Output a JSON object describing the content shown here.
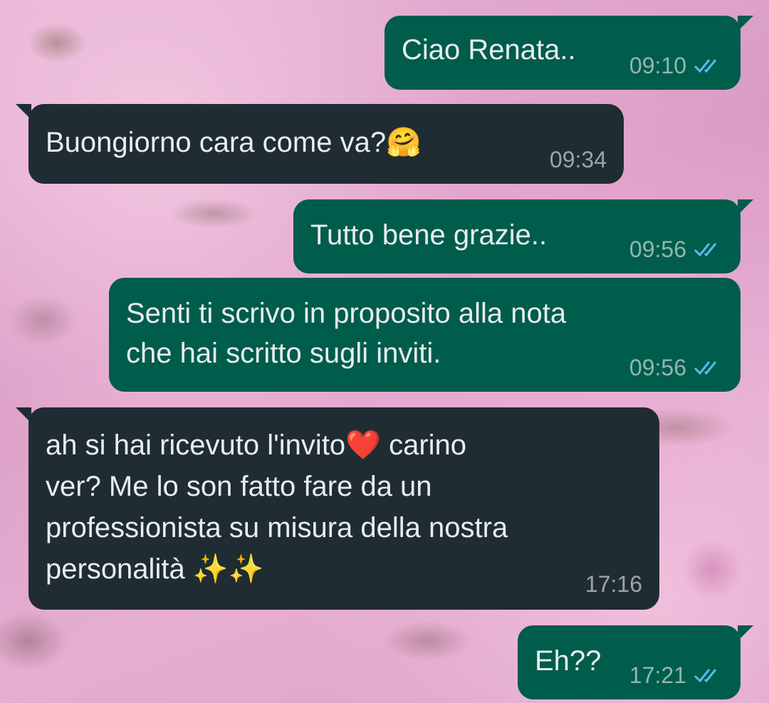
{
  "chat": {
    "messages": [
      {
        "direction": "out",
        "text": "Ciao Renata..",
        "time": "09:10",
        "status": "read-ticks-icon"
      },
      {
        "direction": "in",
        "text": "Buongiorno cara come va?🤗",
        "time": "09:34"
      },
      {
        "direction": "out",
        "text": "Tutto bene grazie..",
        "time": "09:56",
        "status": "read-ticks-icon"
      },
      {
        "direction": "out",
        "text": "Senti ti scrivo in proposito alla nota\nche hai scritto sugli inviti.",
        "time": "09:56",
        "status": "read-ticks-icon"
      },
      {
        "direction": "in",
        "text": "ah si hai ricevuto l'invito❤️ carino\nver? Me lo son fatto fare da un\nprofessionista su misura della nostra\npersonalità ✨✨",
        "time": "17:16"
      },
      {
        "direction": "out",
        "text": "Eh??",
        "time": "17:21",
        "status": "read-ticks-icon"
      }
    ]
  },
  "colors": {
    "outgoing_bubble": "#005c4b",
    "incoming_bubble": "#202c33",
    "read_ticks": "#53bdeb",
    "text": "#e9edef"
  }
}
